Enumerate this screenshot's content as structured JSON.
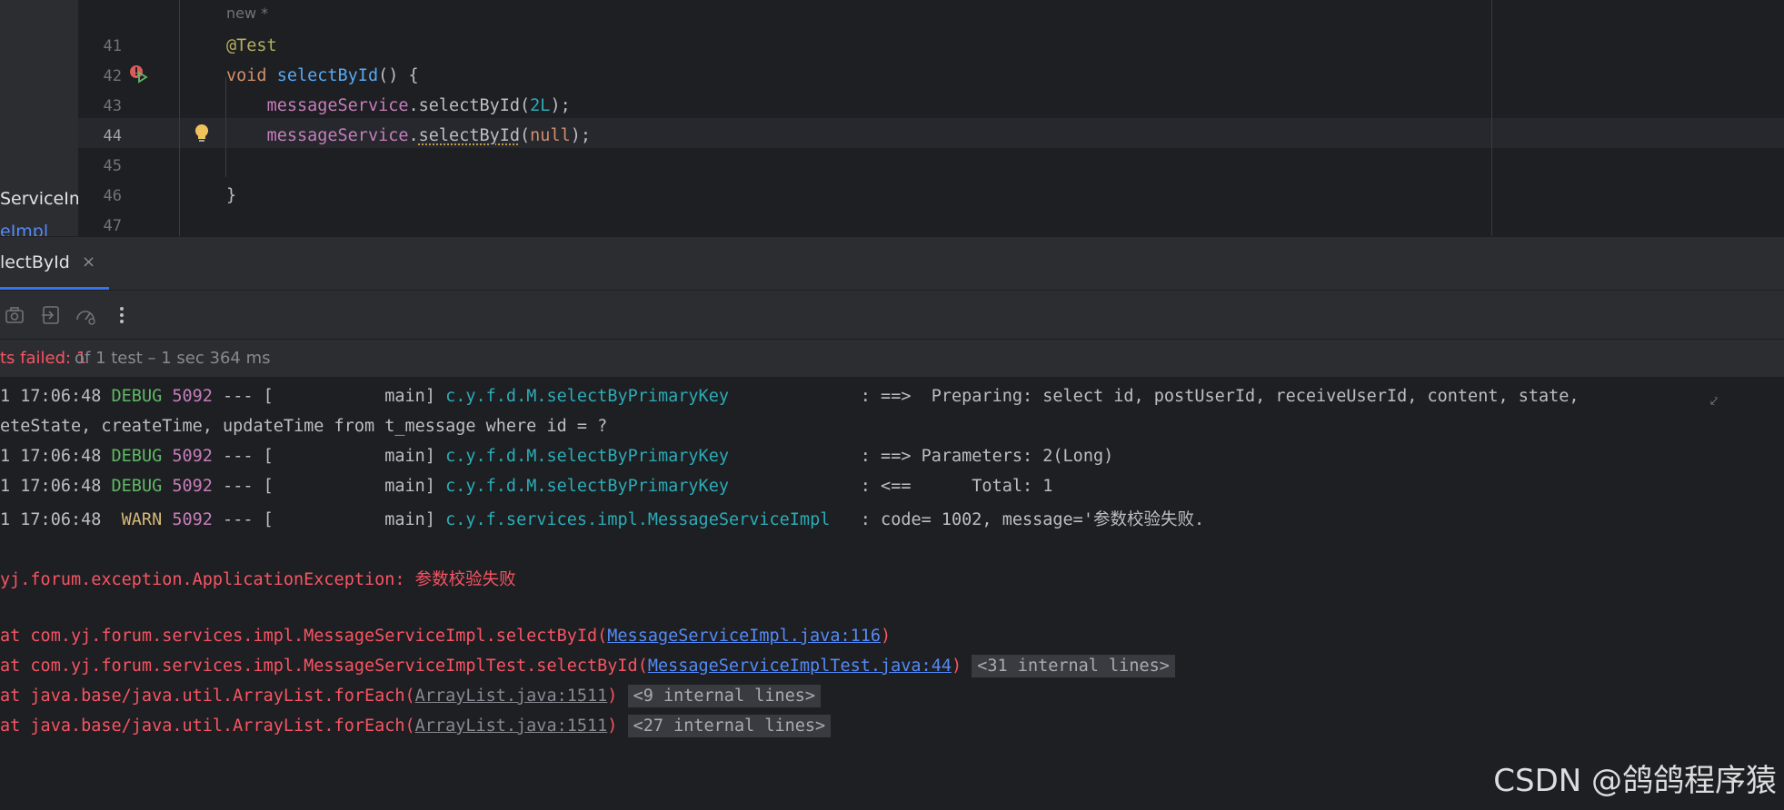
{
  "editor": {
    "file_strip": [
      "ServiceIm",
      "eImpl"
    ],
    "hint": "new *",
    "lines": [
      {
        "n": "41",
        "parts": [
          {
            "c": "ann",
            "t": "@Test"
          }
        ]
      },
      {
        "n": "42",
        "parts": [
          {
            "c": "kw",
            "t": "void "
          },
          {
            "c": "fn",
            "t": "selectById"
          },
          {
            "c": "",
            "t": "() {"
          }
        ]
      },
      {
        "n": "43",
        "parts": [
          {
            "c": "",
            "t": "    "
          },
          {
            "c": "fld",
            "t": "messageService"
          },
          {
            "c": "",
            "t": ".selectById("
          },
          {
            "c": "num",
            "t": "2L"
          },
          {
            "c": "",
            "t": ");"
          }
        ]
      },
      {
        "n": "44",
        "parts": [
          {
            "c": "",
            "t": "    "
          },
          {
            "c": "fld",
            "t": "messageService"
          },
          {
            "c": "",
            "t": "."
          },
          {
            "c": "warnul",
            "t": "selectById"
          },
          {
            "c": "",
            "t": "("
          },
          {
            "c": "kw",
            "t": "null"
          },
          {
            "c": "",
            "t": ");"
          }
        ]
      },
      {
        "n": "45",
        "parts": []
      },
      {
        "n": "46",
        "parts": [
          {
            "c": "",
            "t": "}"
          }
        ]
      },
      {
        "n": "47",
        "parts": []
      }
    ]
  },
  "tab": {
    "label": "lectById",
    "close": "×"
  },
  "toolbar": {
    "icons": [
      "camera-icon",
      "export-icon",
      "performance-icon",
      "more-options-icon"
    ]
  },
  "status": {
    "failed": "ts failed: 1",
    "rest": " of 1 test – 1 sec 364 ms"
  },
  "console": {
    "lines": [
      [
        {
          "c": "",
          "t": "1 17:06:48 "
        },
        {
          "c": "dbg",
          "t": "DEBUG "
        },
        {
          "c": "pid",
          "t": "5092"
        },
        {
          "c": "",
          "t": " --- [           main] "
        },
        {
          "c": "cat",
          "t": "c.y.f.d.M.selectByPrimaryKey            "
        },
        {
          "c": "",
          "t": " : ==>  Preparing: select id, postUserId, receiveUserId, content, state,"
        }
      ],
      [
        {
          "c": "",
          "t": "eteState, createTime, updateTime from t_message where id = ?"
        }
      ],
      [
        {
          "c": "",
          "t": "1 17:06:48 "
        },
        {
          "c": "dbg",
          "t": "DEBUG "
        },
        {
          "c": "pid",
          "t": "5092"
        },
        {
          "c": "",
          "t": " --- [           main] "
        },
        {
          "c": "cat",
          "t": "c.y.f.d.M.selectByPrimaryKey            "
        },
        {
          "c": "",
          "t": " : ==> Parameters: 2(Long)"
        }
      ],
      [
        {
          "c": "",
          "t": "1 17:06:48 "
        },
        {
          "c": "dbg",
          "t": "DEBUG "
        },
        {
          "c": "pid",
          "t": "5092"
        },
        {
          "c": "",
          "t": " --- [           main] "
        },
        {
          "c": "cat",
          "t": "c.y.f.d.M.selectByPrimaryKey            "
        },
        {
          "c": "",
          "t": " : <==      Total: 1"
        }
      ],
      [
        {
          "c": "",
          "t": "1 17:06:48  "
        },
        {
          "c": "wrn",
          "t": "WARN "
        },
        {
          "c": "pid",
          "t": "5092"
        },
        {
          "c": "",
          "t": " --- [           main] "
        },
        {
          "c": "cat",
          "t": "c.y.f.services.impl.MessageServiceImpl  "
        },
        {
          "c": "",
          "t": " : code= 1002, message='参数校验失败."
        }
      ],
      [],
      [
        {
          "c": "err",
          "t": "yj.forum.exception.ApplicationException: 参数校验失败"
        }
      ],
      [],
      [
        {
          "c": "err",
          "t": "at com.yj.forum.services.impl.MessageServiceImpl.selectById("
        },
        {
          "c": "lnk",
          "t": "MessageServiceImpl.java:116"
        },
        {
          "c": "err",
          "t": ")"
        }
      ],
      [
        {
          "c": "err",
          "t": "at com.yj.forum.services.impl.MessageServiceImplTest.selectById("
        },
        {
          "c": "lnk",
          "t": "MessageServiceImplTest.java:44"
        },
        {
          "c": "err",
          "t": ")"
        },
        {
          "c": "",
          "t": " "
        },
        {
          "c": "fold",
          "t": "<31 internal lines>"
        }
      ],
      [
        {
          "c": "err",
          "t": "at java.base/java.util.ArrayList.forEach("
        },
        {
          "c": "lnkg",
          "t": "ArrayList.java:1511"
        },
        {
          "c": "err",
          "t": ")"
        },
        {
          "c": "",
          "t": " "
        },
        {
          "c": "fold",
          "t": "<9 internal lines>"
        }
      ],
      [
        {
          "c": "err",
          "t": "at java.base/java.util.ArrayList.forEach("
        },
        {
          "c": "lnkg",
          "t": "ArrayList.java:1511"
        },
        {
          "c": "err",
          "t": ")"
        },
        {
          "c": "",
          "t": " "
        },
        {
          "c": "fold",
          "t": "<27 internal lines>"
        }
      ]
    ]
  },
  "watermark": "CSDN @鸽鸽程序猿"
}
